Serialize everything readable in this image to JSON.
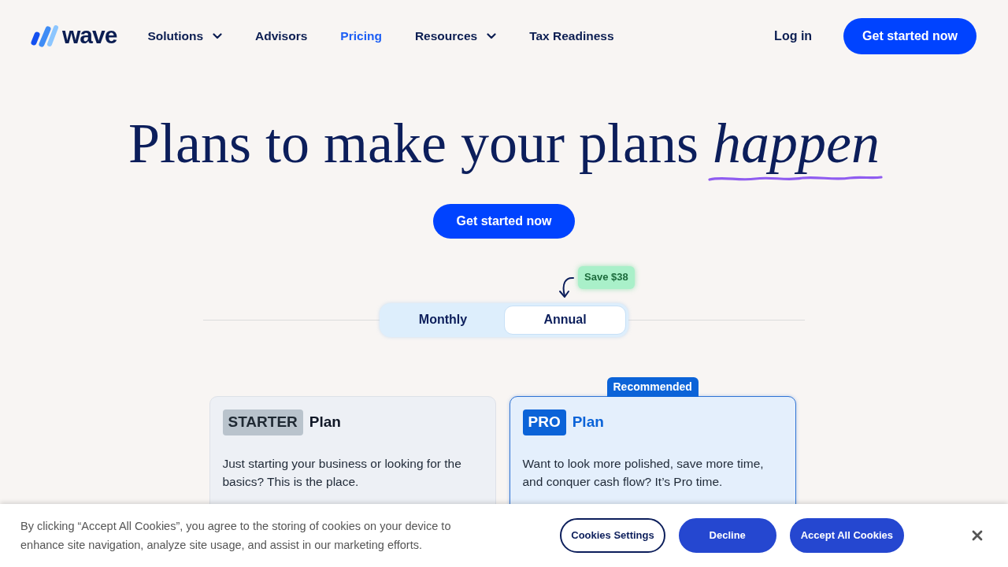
{
  "nav": {
    "logo": {
      "text": "wave"
    },
    "items": [
      {
        "label": "Solutions",
        "selected": false,
        "dropdown": true
      },
      {
        "label": "Advisors",
        "selected": false,
        "dropdown": false
      },
      {
        "label": "Pricing",
        "selected": true,
        "dropdown": false
      },
      {
        "label": "Resources",
        "selected": false,
        "dropdown": true
      },
      {
        "label": "Tax Readiness",
        "selected": false,
        "dropdown": false
      }
    ],
    "login": "Log in",
    "cta": "Get started now"
  },
  "hero": {
    "headline": "Plans to make your plans *happen*",
    "cta": "Get started now"
  },
  "billing": {
    "badge": "Save $38",
    "options": [
      {
        "label": "Monthly",
        "selected": false
      },
      {
        "label": "Annual",
        "selected": true
      }
    ]
  },
  "plans": [
    {
      "kind": "starter",
      "tag": "STARTER",
      "title": "Plan",
      "description": "Just starting your business or looking for the basics? This is the place.",
      "recommended": false
    },
    {
      "kind": "pro",
      "tag": "PRO",
      "title": "Plan",
      "description": "Want to look more polished, save more time, and conquer cash flow? It’s Pro time.",
      "recommended": true,
      "ribbon": "Recommended"
    }
  ],
  "cookie_banner": {
    "text": "By clicking “Accept All Cookies”, you agree to the storing of cookies on your device to enhance site navigation, analyze site usage, and assist in our marketing efforts.",
    "buttons": [
      {
        "label": "Cookies Settings",
        "kind": "outline"
      },
      {
        "label": "Decline",
        "kind": "filled"
      },
      {
        "label": "Accept All Cookies",
        "kind": "filled"
      }
    ]
  }
}
